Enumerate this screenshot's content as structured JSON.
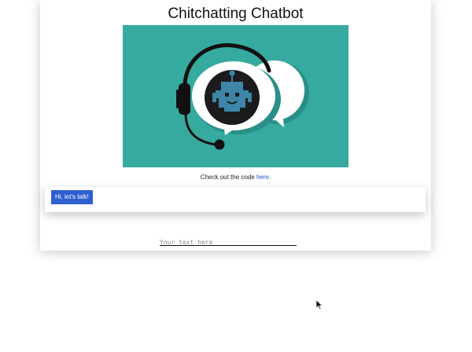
{
  "header": {
    "title": "Chitchatting Chatbot"
  },
  "hero": {
    "icon": "chatbot-headset-icon",
    "bg_color": "#37aa9f"
  },
  "caption": {
    "text": "Check out the code ",
    "link_text": "here",
    "suffix": "."
  },
  "chat": {
    "messages": [
      {
        "sender": "bot",
        "text": "Hi, let's talk!"
      }
    ],
    "bubble_color": "#2f5fcf"
  },
  "input": {
    "placeholder": "Your text here",
    "value": ""
  }
}
